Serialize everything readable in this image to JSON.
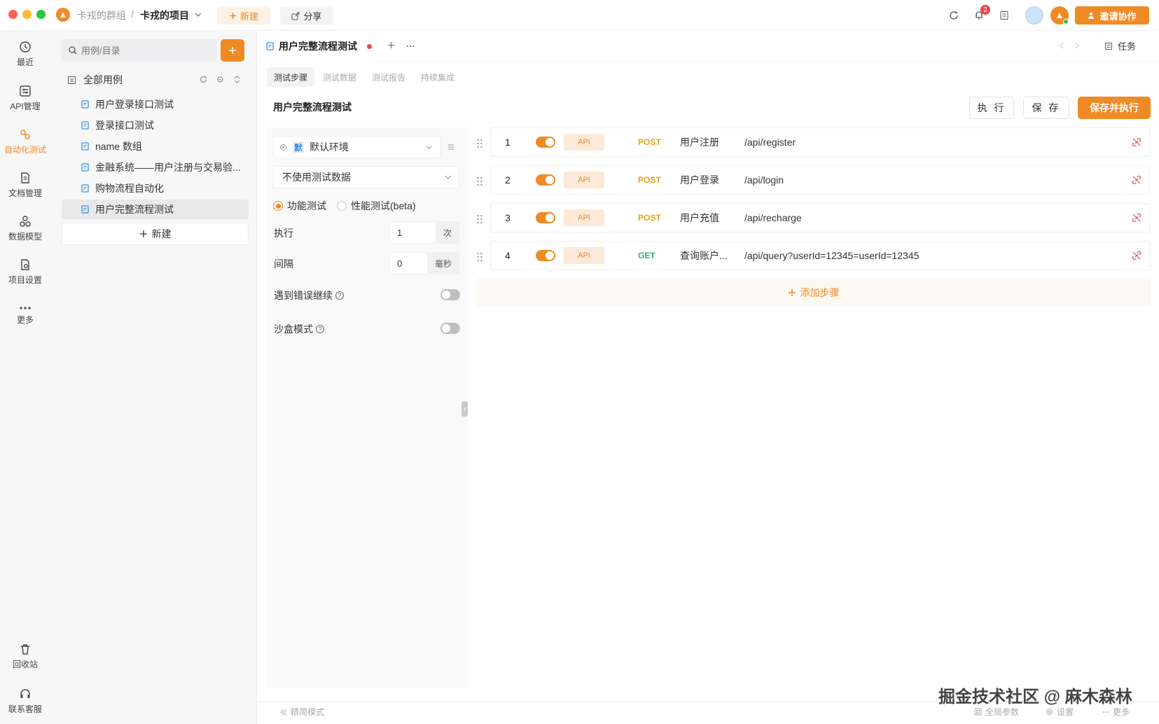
{
  "titlebar": {
    "group": "卡戎的群组",
    "separator": "/",
    "project": "卡戎的项目",
    "new_label": "新建",
    "share_label": "分享",
    "notification_count": "2",
    "invite_label": "邀请协作"
  },
  "rail": {
    "items": [
      {
        "label": "最近"
      },
      {
        "label": "API管理"
      },
      {
        "label": "自动化测试"
      },
      {
        "label": "文档管理"
      },
      {
        "label": "数据模型"
      },
      {
        "label": "项目设置"
      },
      {
        "label": "更多"
      }
    ],
    "bottom": [
      {
        "label": "回收站"
      },
      {
        "label": "联系客服"
      }
    ]
  },
  "tree": {
    "search_placeholder": "用例/目录",
    "root_label": "全部用例",
    "items": [
      {
        "label": "用户登录接口测试"
      },
      {
        "label": "登录接口测试"
      },
      {
        "label": "name 数组"
      },
      {
        "label": "金融系统——用户注册与交易验..."
      },
      {
        "label": "购物流程自动化"
      },
      {
        "label": "用户完整流程测试"
      }
    ],
    "new_label": "新建"
  },
  "main": {
    "tab_title": "用户完整流程测试",
    "tasks_label": "任务",
    "subtabs": [
      "测试步骤",
      "测试数据",
      "测试报告",
      "持续集成"
    ],
    "case_title": "用户完整流程测试",
    "run_label": "执 行",
    "save_label": "保 存",
    "save_run_label": "保存并执行"
  },
  "config": {
    "env_badge": "默",
    "env_name": "默认环境",
    "data_select": "不使用测试数据",
    "mode_functional": "功能测试",
    "mode_perf": "性能测试(beta)",
    "exec_label": "执行",
    "exec_value": "1",
    "exec_unit": "次",
    "interval_label": "间隔",
    "interval_value": "0",
    "interval_unit": "毫秒",
    "continue_on_error_label": "遇到错误继续",
    "sandbox_label": "沙盒模式"
  },
  "steps": [
    {
      "index": "1",
      "tag": "API",
      "method": "POST",
      "name": "用户注册",
      "path": "/api/register"
    },
    {
      "index": "2",
      "tag": "API",
      "method": "POST",
      "name": "用户登录",
      "path": "/api/login"
    },
    {
      "index": "3",
      "tag": "API",
      "method": "POST",
      "name": "用户充值",
      "path": "/api/recharge"
    },
    {
      "index": "4",
      "tag": "API",
      "method": "GET",
      "name": "查询账户...",
      "path": "/api/query?userId=12345=userId=12345"
    }
  ],
  "add_step_label": "添加步骤",
  "bottom": {
    "simple_mode": "精简模式",
    "global_params": "全局参数",
    "settings": "设置",
    "more": "更多"
  },
  "watermark": "掘金技术社区 @ 麻木森林",
  "colors": {
    "accent": "#f08a24",
    "post": "#e8a317",
    "get": "#2bb673",
    "record_dot": "#e5484d"
  }
}
